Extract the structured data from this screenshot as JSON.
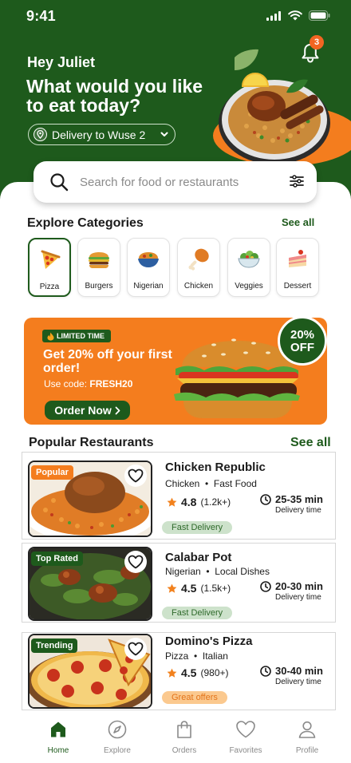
{
  "status_bar": {
    "time": "9:41"
  },
  "header": {
    "greeting": "Hey Juliet",
    "headline": "What would you like to eat today?",
    "location_label": "Delivery to Wuse 2",
    "notification_count": "3"
  },
  "search": {
    "placeholder": "Search for food or restaurants"
  },
  "categories": {
    "title": "Explore Categories",
    "see_all": "See all",
    "items": [
      {
        "label": "Pizza",
        "icon": "pizza-icon",
        "selected": true
      },
      {
        "label": "Burgers",
        "icon": "burger-icon"
      },
      {
        "label": "Nigerian",
        "icon": "nigerian-dish-icon"
      },
      {
        "label": "Chicken",
        "icon": "chicken-leg-icon"
      },
      {
        "label": "Veggies",
        "icon": "salad-icon"
      },
      {
        "label": "Dessert",
        "icon": "cake-icon"
      }
    ]
  },
  "promo": {
    "tag": "LIMITED TIME",
    "title": "Get 20% off your first order!",
    "code_prefix": "Use code: ",
    "code": "FRESH20",
    "button": "Order Now",
    "badge_top": "20%",
    "badge_bottom": "OFF"
  },
  "restaurants": {
    "title": "Popular Restaurants",
    "see_all": "See all",
    "items": [
      {
        "badge": "Popular",
        "name": "Chicken Republic",
        "cuisine_1": "Chicken",
        "cuisine_2": "Fast Food",
        "rating": "4.8",
        "reviews": "(1.2k+)",
        "time": "25-35 min",
        "time_label": "Delivery time",
        "pill": "Fast Delivery"
      },
      {
        "badge": "Top Rated",
        "name": "Calabar Pot",
        "cuisine_1": "Nigerian",
        "cuisine_2": "Local Dishes",
        "rating": "4.5",
        "reviews": "(1.5k+)",
        "time": "20-30 min",
        "time_label": "Delivery time",
        "pill": "Fast Delivery"
      },
      {
        "badge": "Trending",
        "name": "Domino's Pizza",
        "cuisine_1": "Pizza",
        "cuisine_2": "Italian",
        "rating": "4.5",
        "reviews": "(980+)",
        "time": "30-40 min",
        "time_label": "Delivery time",
        "pill": "Great offers"
      }
    ]
  },
  "nav": {
    "items": [
      {
        "label": "Home",
        "icon": "home-icon",
        "active": true
      },
      {
        "label": "Explore",
        "icon": "compass-icon"
      },
      {
        "label": "Orders",
        "icon": "shopping-bag-icon"
      },
      {
        "label": "Favorites",
        "icon": "heart-icon"
      },
      {
        "label": "Profile",
        "icon": "user-icon"
      }
    ]
  },
  "colors": {
    "brand_green": "#1e5a1c",
    "accent_orange": "#f47d1e",
    "star": "#f2811d"
  }
}
